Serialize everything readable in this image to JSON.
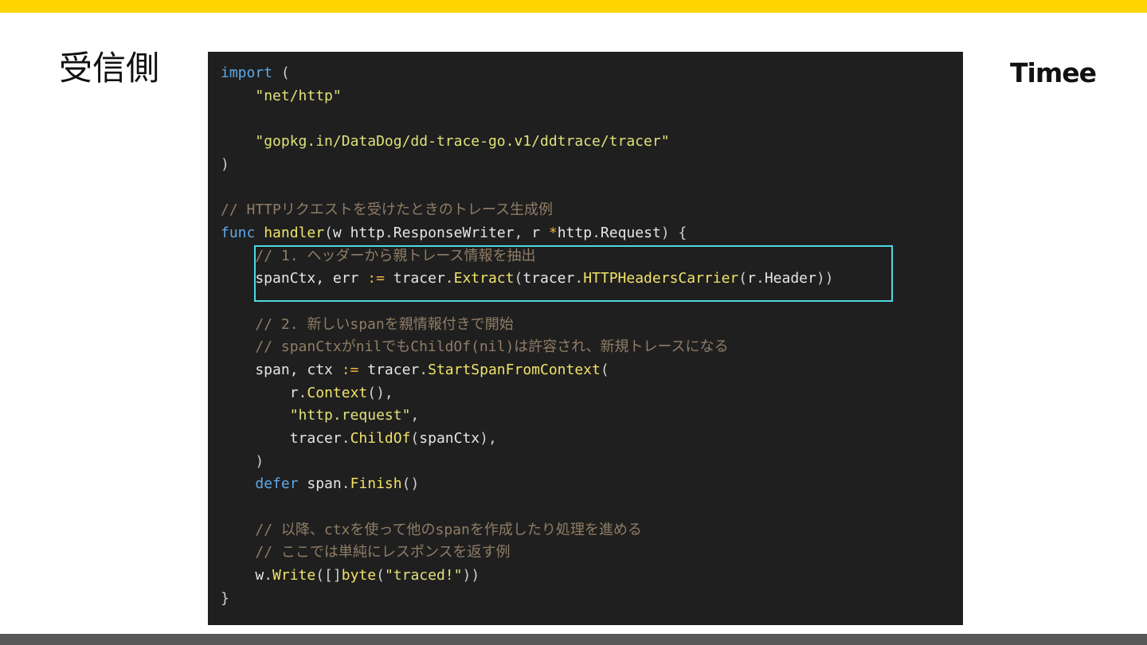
{
  "slide": {
    "title": "受信側",
    "logo_text": "Timee"
  },
  "colors": {
    "top_bar": "#ffd500",
    "bottom_bar": "#595959",
    "code_background": "#1f1f1f",
    "highlight_border": "#4fd8e6"
  },
  "code": {
    "language": "go",
    "lines": [
      [
        {
          "t": "keyword",
          "v": "import"
        },
        {
          "t": "punct",
          "v": " ("
        }
      ],
      [
        {
          "t": "ident",
          "v": "    "
        },
        {
          "t": "string",
          "v": "\"net/http\""
        }
      ],
      [],
      [
        {
          "t": "ident",
          "v": "    "
        },
        {
          "t": "string",
          "v": "\"gopkg.in/DataDog/dd-trace-go.v1/ddtrace/tracer\""
        }
      ],
      [
        {
          "t": "punct",
          "v": ")"
        }
      ],
      [],
      [
        {
          "t": "comment",
          "v": "// HTTPリクエストを受けたときのトレース生成例"
        }
      ],
      [
        {
          "t": "keyword",
          "v": "func"
        },
        {
          "t": "ident",
          "v": " "
        },
        {
          "t": "func",
          "v": "handler"
        },
        {
          "t": "punct",
          "v": "("
        },
        {
          "t": "ident",
          "v": "w http"
        },
        {
          "t": "punct",
          "v": "."
        },
        {
          "t": "ident",
          "v": "ResponseWriter"
        },
        {
          "t": "punct",
          "v": ", "
        },
        {
          "t": "ident",
          "v": "r "
        },
        {
          "t": "op",
          "v": "*"
        },
        {
          "t": "ident",
          "v": "http"
        },
        {
          "t": "punct",
          "v": "."
        },
        {
          "t": "ident",
          "v": "Request"
        },
        {
          "t": "punct",
          "v": ") {"
        }
      ],
      [
        {
          "t": "ident",
          "v": "    "
        },
        {
          "t": "comment",
          "v": "// 1. ヘッダーから親トレース情報を抽出"
        }
      ],
      [
        {
          "t": "ident",
          "v": "    spanCtx, err "
        },
        {
          "t": "op",
          "v": ":="
        },
        {
          "t": "ident",
          "v": " tracer"
        },
        {
          "t": "punct",
          "v": "."
        },
        {
          "t": "func",
          "v": "Extract"
        },
        {
          "t": "punct",
          "v": "("
        },
        {
          "t": "ident",
          "v": "tracer"
        },
        {
          "t": "punct",
          "v": "."
        },
        {
          "t": "func",
          "v": "HTTPHeadersCarrier"
        },
        {
          "t": "punct",
          "v": "("
        },
        {
          "t": "ident",
          "v": "r"
        },
        {
          "t": "punct",
          "v": "."
        },
        {
          "t": "ident",
          "v": "Header"
        },
        {
          "t": "punct",
          "v": "))"
        }
      ],
      [],
      [
        {
          "t": "ident",
          "v": "    "
        },
        {
          "t": "comment",
          "v": "// 2. 新しいspanを親情報付きで開始"
        }
      ],
      [
        {
          "t": "ident",
          "v": "    "
        },
        {
          "t": "comment",
          "v": "// spanCtxがnilでもChildOf(nil)は許容され、新規トレースになる"
        }
      ],
      [
        {
          "t": "ident",
          "v": "    span, ctx "
        },
        {
          "t": "op",
          "v": ":="
        },
        {
          "t": "ident",
          "v": " tracer"
        },
        {
          "t": "punct",
          "v": "."
        },
        {
          "t": "func",
          "v": "StartSpanFromContext"
        },
        {
          "t": "punct",
          "v": "("
        }
      ],
      [
        {
          "t": "ident",
          "v": "        r"
        },
        {
          "t": "punct",
          "v": "."
        },
        {
          "t": "func",
          "v": "Context"
        },
        {
          "t": "punct",
          "v": "(),"
        }
      ],
      [
        {
          "t": "ident",
          "v": "        "
        },
        {
          "t": "string",
          "v": "\"http.request\""
        },
        {
          "t": "punct",
          "v": ","
        }
      ],
      [
        {
          "t": "ident",
          "v": "        tracer"
        },
        {
          "t": "punct",
          "v": "."
        },
        {
          "t": "func",
          "v": "ChildOf"
        },
        {
          "t": "punct",
          "v": "("
        },
        {
          "t": "ident",
          "v": "spanCtx"
        },
        {
          "t": "punct",
          "v": "),"
        }
      ],
      [
        {
          "t": "ident",
          "v": "    "
        },
        {
          "t": "punct",
          "v": ")"
        }
      ],
      [
        {
          "t": "ident",
          "v": "    "
        },
        {
          "t": "keyword",
          "v": "defer"
        },
        {
          "t": "ident",
          "v": " span"
        },
        {
          "t": "punct",
          "v": "."
        },
        {
          "t": "func",
          "v": "Finish"
        },
        {
          "t": "punct",
          "v": "()"
        }
      ],
      [],
      [
        {
          "t": "ident",
          "v": "    "
        },
        {
          "t": "comment",
          "v": "// 以降、ctxを使って他のspanを作成したり処理を進める"
        }
      ],
      [
        {
          "t": "ident",
          "v": "    "
        },
        {
          "t": "comment",
          "v": "// ここでは単純にレスポンスを返す例"
        }
      ],
      [
        {
          "t": "ident",
          "v": "    w"
        },
        {
          "t": "punct",
          "v": "."
        },
        {
          "t": "func",
          "v": "Write"
        },
        {
          "t": "punct",
          "v": "([]"
        },
        {
          "t": "func",
          "v": "byte"
        },
        {
          "t": "punct",
          "v": "("
        },
        {
          "t": "string",
          "v": "\"traced!\""
        },
        {
          "t": "punct",
          "v": "))"
        }
      ],
      [
        {
          "t": "punct",
          "v": "}"
        }
      ]
    ]
  }
}
